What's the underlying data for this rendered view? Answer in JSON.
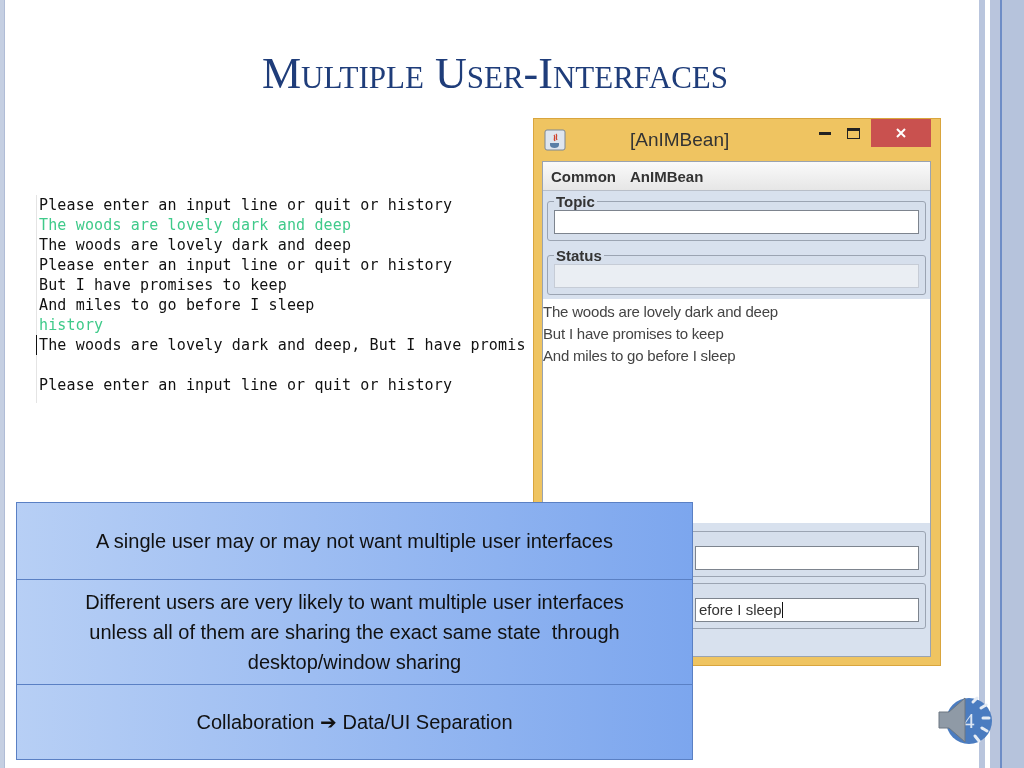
{
  "slide": {
    "title": "Multiple User-Interfaces",
    "number": "4"
  },
  "console": {
    "lines": [
      {
        "text": "Please enter an input line or quit or history",
        "kind": "output"
      },
      {
        "text": "The woods are lovely dark and deep",
        "kind": "input"
      },
      {
        "text": "The woods are lovely dark and deep",
        "kind": "output"
      },
      {
        "text": "Please enter an input line or quit or history",
        "kind": "output"
      },
      {
        "text": "But I have promises to keep",
        "kind": "output"
      },
      {
        "text": "And miles to go before I sleep",
        "kind": "output"
      },
      {
        "text": "history",
        "kind": "input"
      },
      {
        "text": "The woods are lovely dark and deep, But I have promis",
        "kind": "output",
        "caret": true
      },
      {
        "text": "Please enter an input line or quit or history",
        "kind": "output",
        "spaced": true
      }
    ]
  },
  "window": {
    "title": "[AnIMBean]",
    "menu": [
      "Common",
      "AnIMBean"
    ],
    "groups": [
      {
        "label": "Topic",
        "disabled": false
      },
      {
        "label": "Status",
        "disabled": true
      }
    ],
    "text_lines": [
      "The woods are lovely dark and deep",
      "But I have promises to keep",
      "And miles to go before I sleep"
    ],
    "bottom_fields": [
      {
        "disabled": false
      },
      {
        "disabled": false,
        "value": "efore I sleep",
        "caret": true
      }
    ]
  },
  "callout": {
    "rows": [
      "A single user may or may not want multiple user interfaces",
      "Different users are very likely to want multiple user interfaces unless all of them are sharing the exact same state  through desktop/window sharing",
      "Collaboration ➔ Data/UI Separation"
    ]
  }
}
